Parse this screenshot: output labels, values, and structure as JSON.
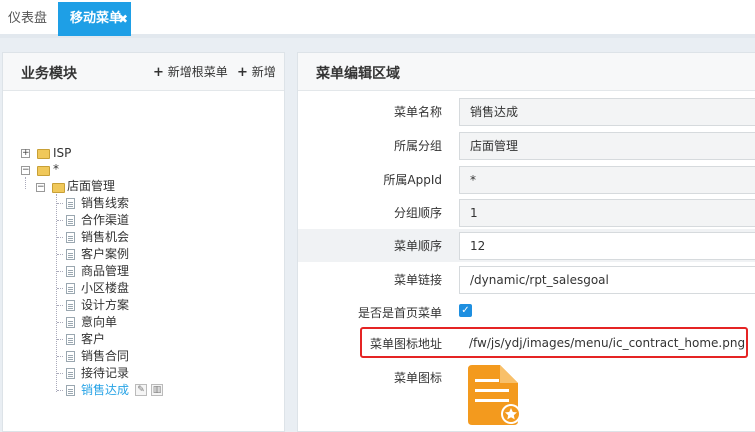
{
  "tabs": [
    {
      "label": "仪表盘"
    },
    {
      "label": "移动菜单",
      "close": "✖"
    }
  ],
  "left_panel": {
    "title": "业务模块",
    "btn_add_root": "新增根菜单",
    "btn_add": "新增",
    "tree": {
      "isp": "ISP",
      "star": "*",
      "store": "店面管理",
      "children": [
        "销售线索",
        "合作渠道",
        "销售机会",
        "客户案例",
        "商品管理",
        "小区楼盘",
        "设计方案",
        "意向单",
        "客户",
        "销售合同",
        "接待记录",
        "销售达成"
      ]
    }
  },
  "right_panel": {
    "title": "菜单编辑区域",
    "fields": {
      "name_label": "菜单名称",
      "name_value": "销售达成",
      "group_label": "所属分组",
      "group_value": "店面管理",
      "appid_label": "所属AppId",
      "appid_value": "*",
      "group_order_label": "分组顺序",
      "group_order_value": "1",
      "menu_order_label": "菜单顺序",
      "menu_order_value": "12",
      "link_label": "菜单链接",
      "link_value": "/dynamic/rpt_salesgoal",
      "home_label": "是否是首页菜单",
      "home_checked": true,
      "icon_url_label": "菜单图标地址",
      "icon_url_value": "/fw/js/ydj/images/menu/ic_contract_home.png",
      "icon_label": "菜单图标"
    }
  },
  "colors": {
    "accent": "#1e9fe6",
    "highlight_border": "#e52424",
    "icon_orange": "#f39a1e"
  }
}
